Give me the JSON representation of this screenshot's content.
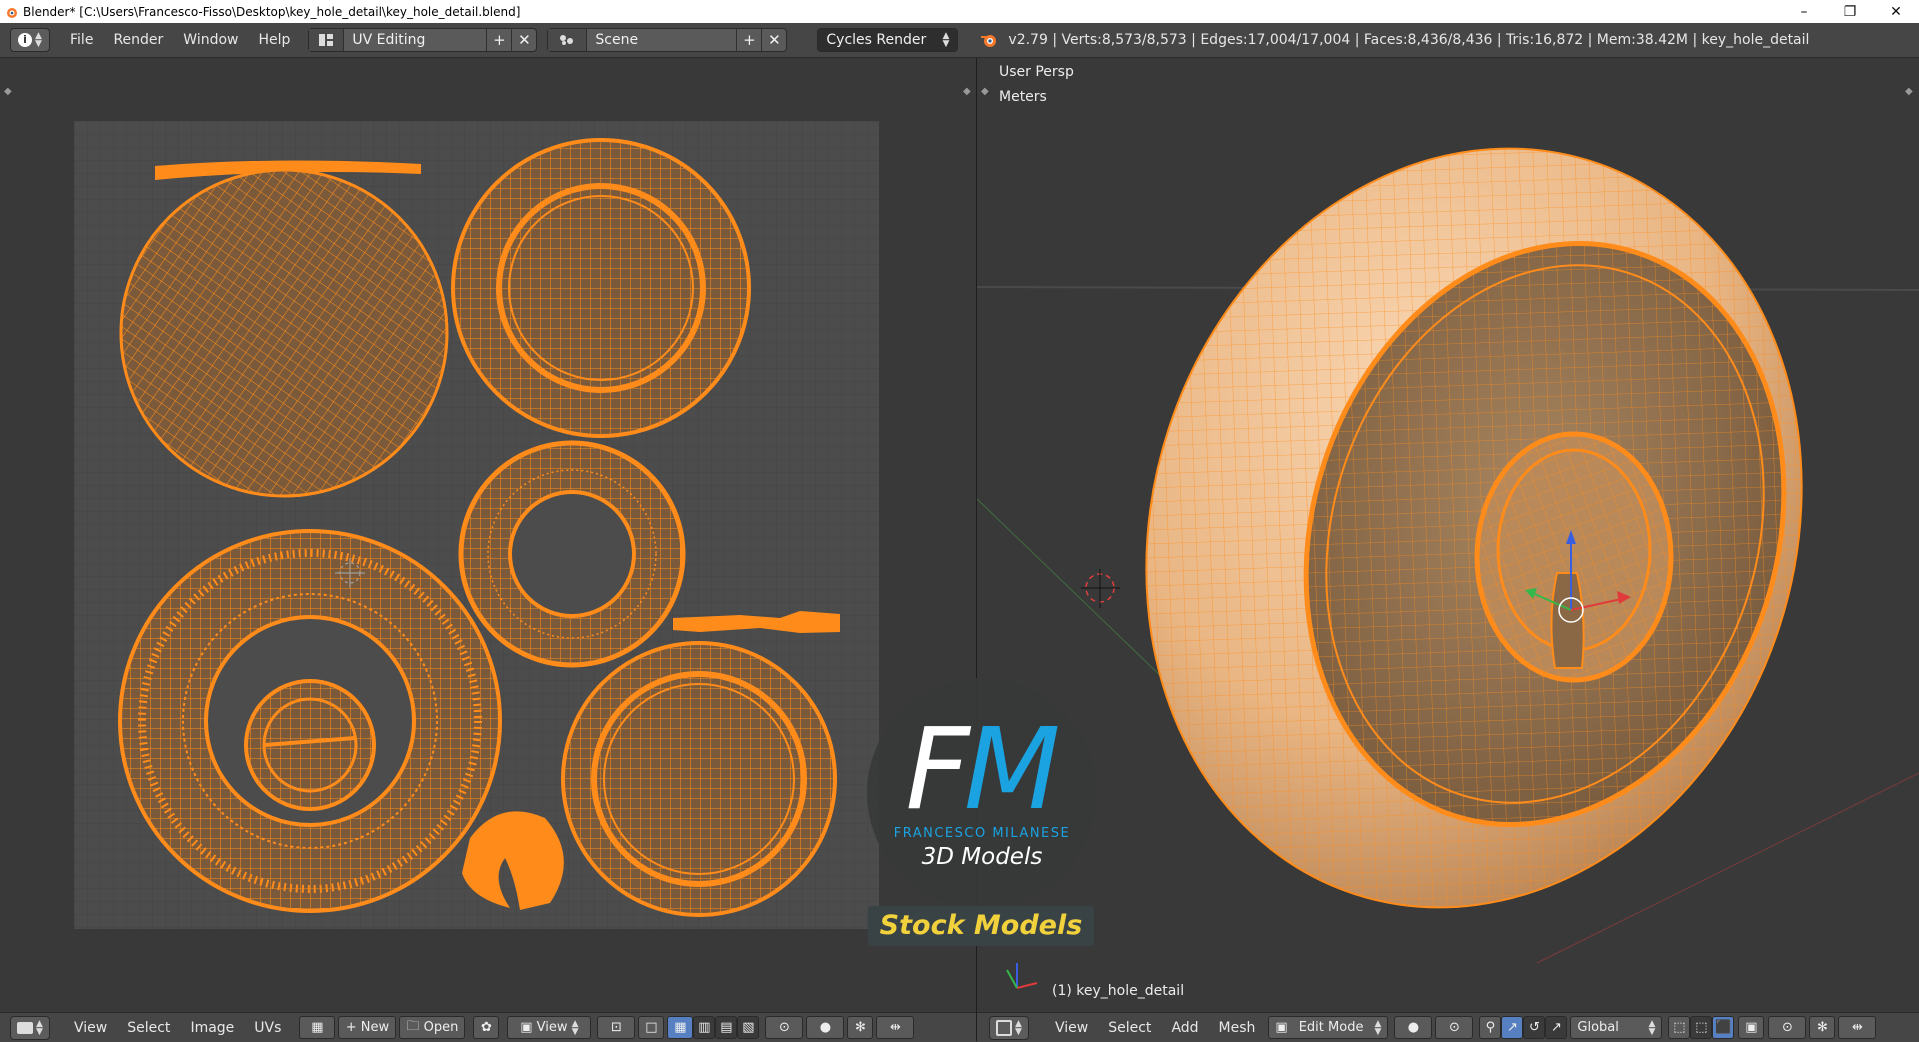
{
  "window": {
    "title": "Blender* [C:\\Users\\Francesco-Fisso\\Desktop\\key_hole_detail\\key_hole_detail.blend]",
    "minimize_icon": "minimize-icon",
    "restore_icon": "restore-icon",
    "close_icon": "close-icon"
  },
  "info_header": {
    "menus": [
      "File",
      "Render",
      "Window",
      "Help"
    ],
    "screen_layout": "UV Editing",
    "scene": "Scene",
    "render_engine": "Cycles Render",
    "stats": "v2.79 | Verts:8,573/8,573 | Edges:17,004/17,004 | Faces:8,436/8,436 | Tris:16,872 | Mem:38.42M | key_hole_detail"
  },
  "uv_editor": {
    "footer": {
      "menus": [
        "View",
        "Select",
        "Image",
        "UVs"
      ],
      "new_label": "New",
      "open_label": "Open",
      "view_label": "View"
    }
  },
  "view3d": {
    "perspective": "User Persp",
    "units": "Meters",
    "object_name": "(1) key_hole_detail",
    "footer": {
      "menus": [
        "View",
        "Select",
        "Add",
        "Mesh"
      ],
      "mode": "Edit Mode",
      "orientation": "Global"
    }
  },
  "watermark": {
    "logo": "FM",
    "brand": "FRANCESCO MILANESE",
    "sub": "3D Models",
    "stock": "Stock Models"
  },
  "colors": {
    "accent_orange": "#ff8c1a",
    "mesh_fill": "#7a5a3a",
    "viewport_bg": "#393939",
    "header_bg": "#464646",
    "logo_blue": "#1aa3e0",
    "stock_yellow": "#f2d23c"
  }
}
